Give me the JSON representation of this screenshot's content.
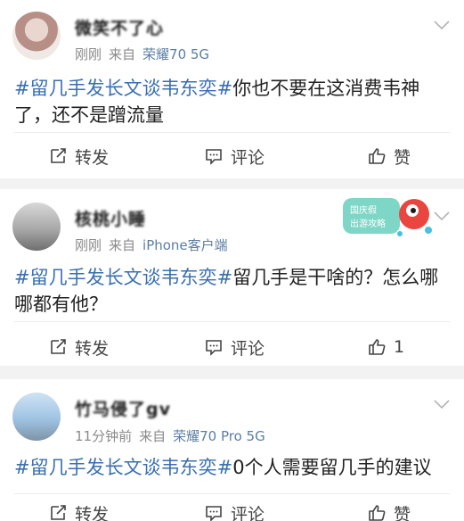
{
  "posts": [
    {
      "username": "微笑不了心",
      "time": "刚刚",
      "source_prefix": "来自",
      "device": "荣耀70 5G",
      "hashtag": "#留几手发长文谈韦东奕#",
      "body": "你也不要在这消费韦神了，还不是蹭流量",
      "repost_label": "转发",
      "comment_label": "评论",
      "like_label": "赞"
    },
    {
      "username": "核桃小睡",
      "time": "刚刚",
      "source_prefix": "来自",
      "device": "iPhone客户端",
      "hashtag": "#留几手发长文谈韦东奕#",
      "body": "留几手是干啥的？怎么哪哪都有他？",
      "repost_label": "转发",
      "comment_label": "评论",
      "like_label": "1"
    },
    {
      "username": "竹马侵了gv",
      "time": "11分钟前",
      "source_prefix": "来自",
      "device": "荣耀70 Pro 5G",
      "hashtag": "#留几手发长文谈韦东奕#",
      "body": "0个人需要留几手的建议",
      "repost_label": "转发",
      "comment_label": "评论",
      "like_label": "赞"
    }
  ],
  "badge": {
    "line1": "国庆假",
    "line2": "出游攻略"
  },
  "colors": {
    "link": "#3a6fb0",
    "device": "#5b7ea5",
    "meta": "#8a8a8a"
  },
  "icons": [
    "repost-icon",
    "comment-icon",
    "like-icon",
    "chevron-down-icon"
  ]
}
